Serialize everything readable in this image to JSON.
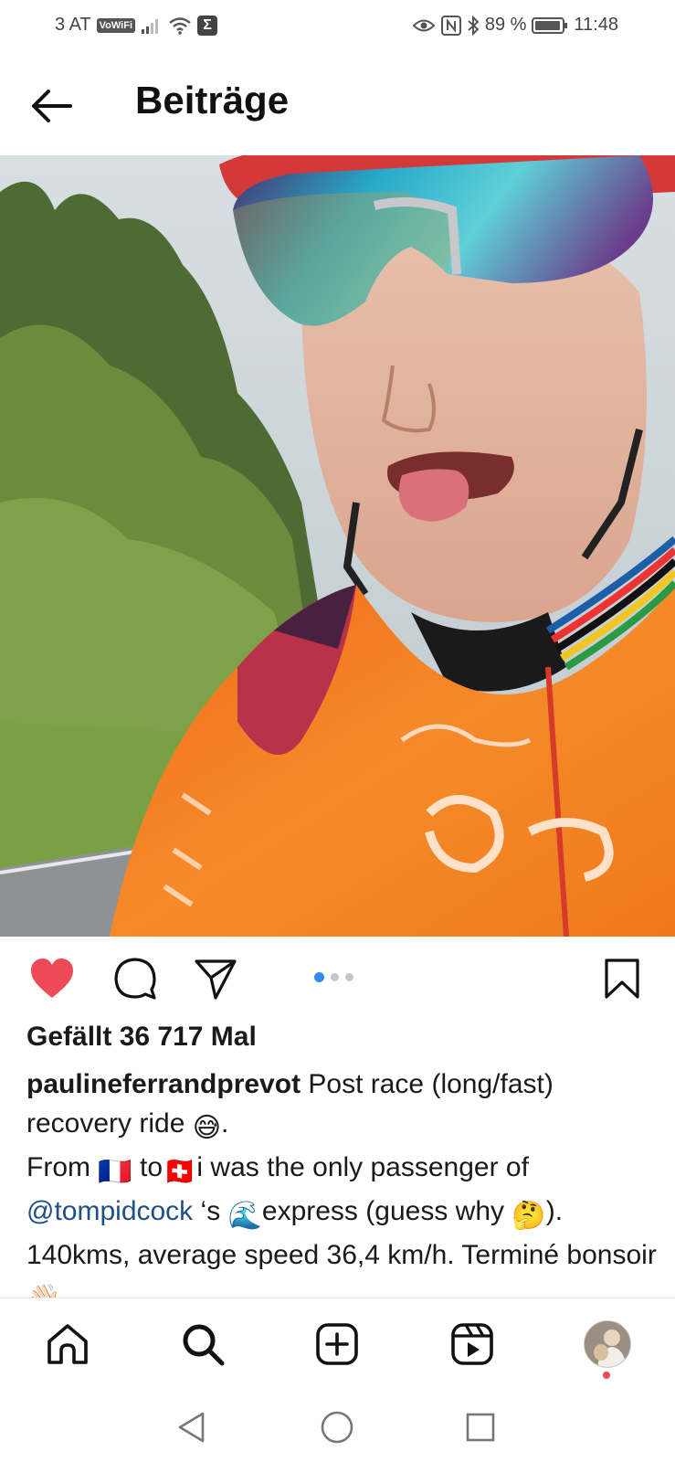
{
  "status_bar": {
    "carrier": "3 AT",
    "vowifi": "VoWiFi",
    "sigma": "Σ",
    "battery_percent": "89 %",
    "time": "11:48",
    "icons": [
      "signal-icon",
      "wifi-icon",
      "eye-icon",
      "nfc-icon",
      "bluetooth-icon",
      "battery-icon"
    ]
  },
  "header": {
    "title": "Beiträge",
    "back_icon": "arrow-left-icon"
  },
  "post": {
    "carousel": {
      "total": 3,
      "active": 1
    },
    "likes_text": "Gefällt 36 717 Mal",
    "username": "paulineferrandprevot",
    "caption_1": " Post race (long/fast) recovery ride ",
    "emoji_sweat": "😅",
    "caption_2": ".",
    "caption_3": "From ",
    "emoji_fr": "🇫🇷",
    "caption_4": " to",
    "emoji_ch": "🇨🇭",
    "caption_5": "i was the only passenger of ",
    "mention": "@tompidcock",
    "caption_6": " ‘s ",
    "emoji_wave": "🌊",
    "caption_7": "express (guess why ",
    "emoji_think": "🤔",
    "caption_8": "). 140kms, average speed 36,4 km/h. Terminé bonsoir ",
    "emoji_hand": "👋🏻"
  },
  "colors": {
    "like": "#ed4956",
    "mention": "#1f4f87",
    "active_dot": "#2d8cf0",
    "jersey": "#f07a1a"
  },
  "bottom_nav": [
    "home-icon",
    "search-icon",
    "create-icon",
    "reels-icon",
    "profile-avatar"
  ],
  "system_nav": [
    "back-icon",
    "home-circle-icon",
    "recents-icon"
  ]
}
